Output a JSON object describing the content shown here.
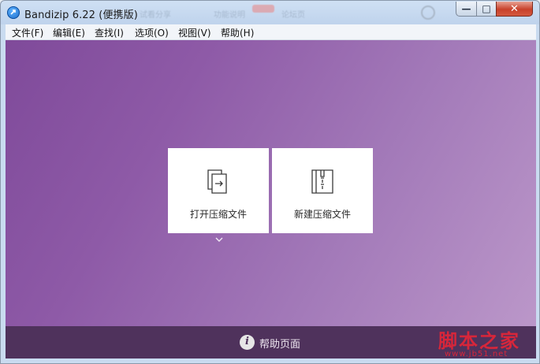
{
  "window": {
    "title": "Bandizip 6.22 (便携版)",
    "ghost_tabs": [
      "试看分享",
      "功能说明",
      "论坛页"
    ]
  },
  "controls": {
    "minimize": "—",
    "maximize": "□",
    "close": "✕"
  },
  "menu": {
    "items": [
      {
        "label": "文件(F)"
      },
      {
        "label": "编辑(E)"
      },
      {
        "label": "查找(I)"
      },
      {
        "label": "选项(O)"
      },
      {
        "label": "视图(V)"
      },
      {
        "label": "帮助(H)"
      }
    ]
  },
  "actions": {
    "open": {
      "label": "打开压缩文件",
      "icon": "open-archive-icon"
    },
    "new": {
      "label": "新建压缩文件",
      "icon": "zip-archive-icon"
    }
  },
  "footer": {
    "help_label": "帮助页面",
    "help_icon_glyph": "i"
  },
  "watermark": {
    "text": "脚本之家",
    "url": "www.jb51.net"
  },
  "colors": {
    "background_start": "#bb97c9",
    "background_end": "#7f4a9a",
    "footer": "#4f325c",
    "watermark": "#d7263a"
  }
}
